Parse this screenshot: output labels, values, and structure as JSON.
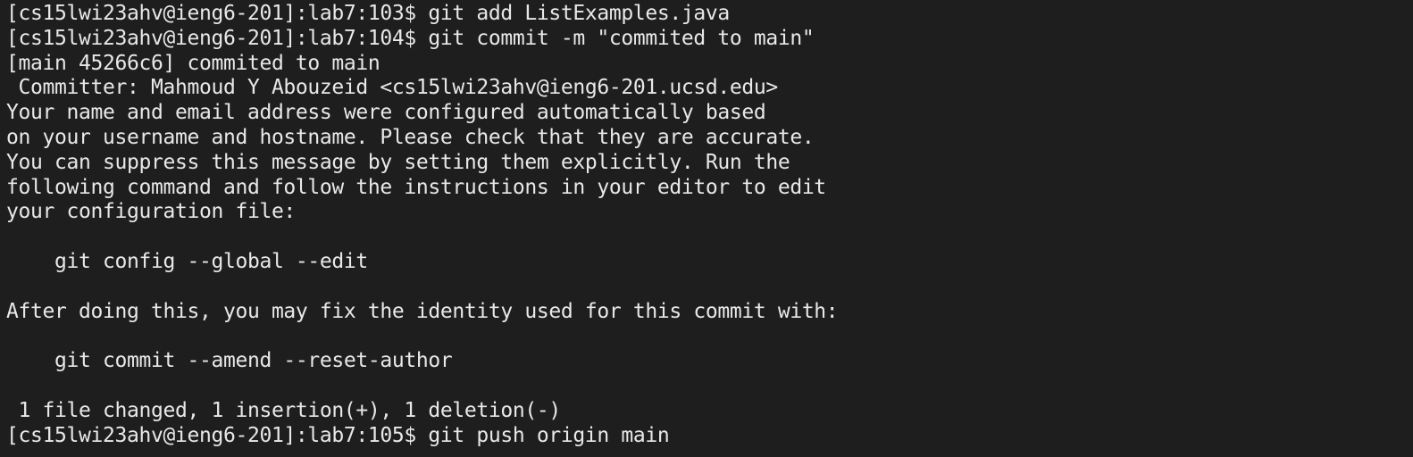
{
  "terminal": {
    "background": "#1e1e1e",
    "foreground": "#e8e8e8",
    "lines": [
      {
        "prompt": "[cs15lwi23ahv@ieng6-201]:lab7:103$ ",
        "command": "git add ListExamples.java"
      },
      {
        "prompt": "[cs15lwi23ahv@ieng6-201]:lab7:104$ ",
        "command": "git commit -m \"commited to main\""
      },
      {
        "text": "[main 45266c6] commited to main"
      },
      {
        "text": " Committer: Mahmoud Y Abouzeid <cs15lwi23ahv@ieng6-201.ucsd.edu>"
      },
      {
        "text": "Your name and email address were configured automatically based"
      },
      {
        "text": "on your username and hostname. Please check that they are accurate."
      },
      {
        "text": "You can suppress this message by setting them explicitly. Run the"
      },
      {
        "text": "following command and follow the instructions in your editor to edit"
      },
      {
        "text": "your configuration file:"
      },
      {
        "text": ""
      },
      {
        "text": "    git config --global --edit"
      },
      {
        "text": ""
      },
      {
        "text": "After doing this, you may fix the identity used for this commit with:"
      },
      {
        "text": ""
      },
      {
        "text": "    git commit --amend --reset-author"
      },
      {
        "text": ""
      },
      {
        "text": " 1 file changed, 1 insertion(+), 1 deletion(-)"
      },
      {
        "prompt": "[cs15lwi23ahv@ieng6-201]:lab7:105$ ",
        "command": "git push origin main"
      }
    ]
  }
}
